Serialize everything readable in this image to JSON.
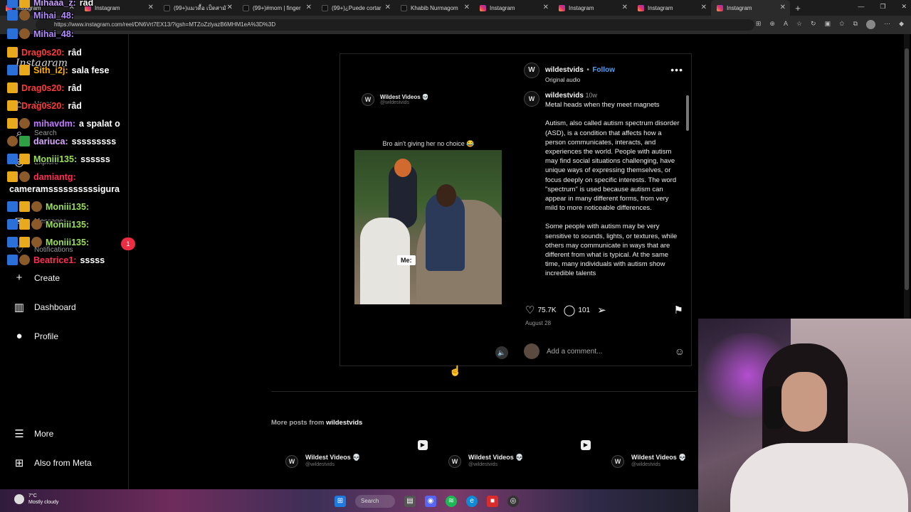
{
  "browser": {
    "tabs": [
      {
        "label": "Instagram",
        "icon": "instagram-icon",
        "active": false
      },
      {
        "label": "Instagram",
        "icon": "instagram-icon",
        "active": false
      },
      {
        "label": "(99+)แมวดื้อ เป็ดสามั",
        "icon": "tiktok-icon",
        "active": false
      },
      {
        "label": "(99+)#mom | finger",
        "icon": "tiktok-icon",
        "active": false
      },
      {
        "label": "(99+)¿Puede cortar",
        "icon": "tiktok-icon",
        "active": false
      },
      {
        "label": "Khabib Nurmagom",
        "icon": "tiktok-icon",
        "active": false
      },
      {
        "label": "Instagram",
        "icon": "instagram-icon",
        "active": false
      },
      {
        "label": "Instagram",
        "icon": "instagram-icon",
        "active": false
      },
      {
        "label": "Instagram",
        "icon": "instagram-icon",
        "active": false
      },
      {
        "label": "Instagram",
        "icon": "instagram-icon",
        "active": true
      }
    ],
    "url": "https://www.instagram.com/reel/DN6Vrt7EX13/?igsh=MTZoZzlyazB6MHM1eA%3D%3D"
  },
  "sidebar": {
    "logo": "Instagram",
    "items": [
      {
        "label": "Home",
        "icon": "home-icon"
      },
      {
        "label": "Search",
        "icon": "search-icon"
      },
      {
        "label": "Explore",
        "icon": "explore-icon"
      },
      {
        "label": "Messages",
        "icon": "messages-icon"
      },
      {
        "label": "Notifications",
        "icon": "heart-icon"
      },
      {
        "label": "Create",
        "icon": "plus-icon"
      },
      {
        "label": "Dashboard",
        "icon": "dashboard-icon"
      },
      {
        "label": "Profile",
        "icon": "profile-icon"
      },
      {
        "label": "More",
        "icon": "menu-icon"
      },
      {
        "label": "Also from Meta",
        "icon": "meta-icon"
      }
    ],
    "notification_count": "1"
  },
  "chat": [
    {
      "user": "Mihaaa_z:",
      "text": "râd",
      "color": "#c9a0ff"
    },
    {
      "user": "Mihai_48:",
      "text": "",
      "color": "#b48cff"
    },
    {
      "user": "Mihai_48:",
      "text": "",
      "color": "#b48cff"
    },
    {
      "user": "Drag0s20:",
      "text": "râd",
      "color": "#ff3b3b"
    },
    {
      "user": "Sith_i2j:",
      "text": "sala fese",
      "color": "#ffb000"
    },
    {
      "user": "Drag0s20:",
      "text": "râd",
      "color": "#ff3b3b"
    },
    {
      "user": "Drag0s20:",
      "text": "râd",
      "color": "#ff3b3b"
    },
    {
      "user": "mihavdm:",
      "text": "a spalat o",
      "color": "#c27cff"
    },
    {
      "user": "dariuca:",
      "text": "sssssssss",
      "color": "#d8a8ff"
    },
    {
      "user": "Moniii135:",
      "text": "ssssss",
      "color": "#9be05a"
    },
    {
      "user": "damiantg:",
      "text": "",
      "color": "#ff2d55"
    },
    {
      "user": "",
      "text": "cameramssssssssssigura",
      "color": "#ffffff"
    },
    {
      "user": "Moniii135:",
      "text": "",
      "color": "#9be05a"
    },
    {
      "user": "Moniii135:",
      "text": "",
      "color": "#9be05a"
    },
    {
      "user": "Moniii135:",
      "text": "",
      "color": "#9be05a"
    },
    {
      "user": "Beatrice1:",
      "text": "sssss",
      "color": "#ff2d55"
    }
  ],
  "post": {
    "account": "wildestvids",
    "follow_label": "Follow",
    "audio": "Original audio",
    "media": {
      "page_name": "Wildest Videos 💀",
      "page_handle": "@wildestvids",
      "overlay_caption": "Bro ain't giving her no choice 😂",
      "label": "Me:"
    },
    "caption": {
      "user": "wildestvids",
      "time": "10w",
      "title": "Metal heads when they meet magnets",
      "p1": "Autism, also called autism spectrum disorder (ASD), is a condition that affects how a person communicates, interacts, and experiences the world. People with autism may find social situations challenging, have unique ways of expressing themselves, or focus deeply on specific interests. The word \"spectrum\" is used because autism can appear in many different forms, from very mild to more noticeable differences.",
      "p2": "Some people with autism may be very sensitive to sounds, lights, or textures, while others may communicate in ways that are different from what is typical. At the same time, many individuals with autism show incredible talents"
    },
    "likes": "75.7K",
    "comments": "101",
    "date": "August 28",
    "comment_placeholder": "Add a comment..."
  },
  "more_posts": {
    "label": "More posts from",
    "account": "wildestvids",
    "cards": [
      {
        "name": "Wildest Videos 💀",
        "handle": "@wildestvids"
      },
      {
        "name": "Wildest Videos 💀",
        "handle": "@wildestvids"
      },
      {
        "name": "Wildest Videos 💀",
        "handle": "@wildestvids"
      }
    ]
  },
  "taskbar": {
    "temp": "7°C",
    "weather": "Mostly cloudy",
    "search": "Search"
  }
}
